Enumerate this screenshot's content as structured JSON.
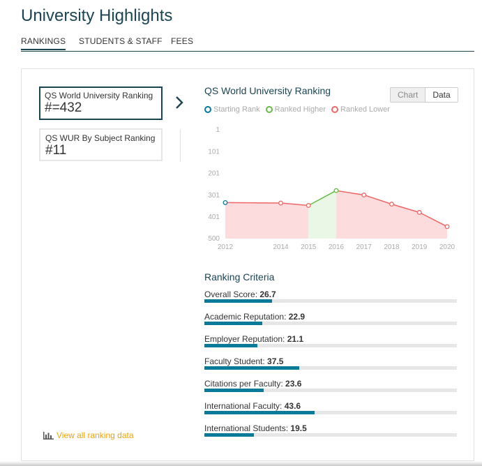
{
  "page": {
    "title": "University Highlights"
  },
  "tabs": [
    {
      "label": "RANKINGS",
      "active": true
    },
    {
      "label": "STUDENTS & STAFF",
      "active": false
    },
    {
      "label": "FEES",
      "active": false
    }
  ],
  "rankings": [
    {
      "label": "QS World University Ranking",
      "value": "#=432",
      "active": true
    },
    {
      "label": "QS WUR By Subject Ranking",
      "value": "#11",
      "active": false
    }
  ],
  "view_all_link": "View all ranking data",
  "chart_panel": {
    "title": "QS World University Ranking",
    "toggle": {
      "chart_label": "Chart",
      "data_label": "Data"
    },
    "legend": [
      {
        "label": "Starting Rank",
        "color": "#007b9a"
      },
      {
        "label": "Ranked Higher",
        "color": "#66bb44"
      },
      {
        "label": "Ranked Lower",
        "color": "#ee6666"
      }
    ]
  },
  "chart_data": {
    "type": "area",
    "title": "QS World University Ranking",
    "x": [
      2012,
      2014,
      2015,
      2016,
      2017,
      2018,
      2019,
      2020
    ],
    "values": [
      335,
      337,
      348,
      280,
      300,
      342,
      380,
      445
    ],
    "y_ticks": [
      "1",
      "101",
      "201",
      "301",
      "401",
      "500"
    ],
    "ylim": [
      500,
      1
    ],
    "y_inverted": true,
    "grid": false,
    "colors": {
      "start": "#007b9a",
      "higher": "#66bb44",
      "lower": "#ee6666"
    }
  },
  "criteria": {
    "title": "Ranking Criteria",
    "items": [
      {
        "label": "Overall Score:",
        "score": "26.7",
        "fraction": 0.267
      },
      {
        "label": "Academic Reputation:",
        "score": "22.9",
        "fraction": 0.229
      },
      {
        "label": "Employer Reputation:",
        "score": "21.1",
        "fraction": 0.211
      },
      {
        "label": "Faculty Student:",
        "score": "37.5",
        "fraction": 0.375
      },
      {
        "label": "Citations per Faculty:",
        "score": "23.6",
        "fraction": 0.236
      },
      {
        "label": "International Faculty:",
        "score": "43.6",
        "fraction": 0.436
      },
      {
        "label": "International Students:",
        "score": "19.5",
        "fraction": 0.195
      }
    ]
  }
}
